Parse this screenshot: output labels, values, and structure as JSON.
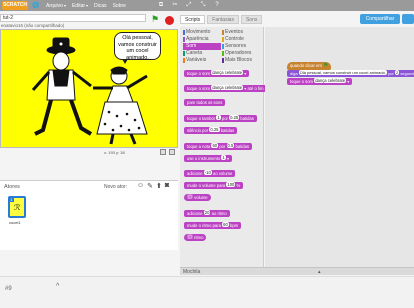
{
  "menubar": {
    "logo": "SCRATCH",
    "menus": [
      {
        "label": "Arquivo"
      },
      {
        "label": "Editar"
      },
      {
        "label": "Dicas"
      },
      {
        "label": "Sobre"
      }
    ]
  },
  "project": {
    "title": "tut-2",
    "subtitle": "enatavio16 (não compartilhado)"
  },
  "stage": {
    "speech": "Olá pessoal, vamos construir um cocel animado.",
    "background_color": "#ffff00",
    "coords": "x: 193  y: 38"
  },
  "sprites": {
    "title": "Atores",
    "new_sprite_label": "Novo ator:",
    "items": [
      {
        "number": "1",
        "name": "cocel1"
      }
    ]
  },
  "tabs": [
    {
      "label": "Scripts",
      "active": true
    },
    {
      "label": "Fantasias",
      "active": false
    },
    {
      "label": "Sons",
      "active": false
    }
  ],
  "share_button": "Compartilhar",
  "categories": [
    {
      "label": "Movimento",
      "key": "motion"
    },
    {
      "label": "Eventos",
      "key": "events"
    },
    {
      "label": "Aparência",
      "key": "looks"
    },
    {
      "label": "Controle",
      "key": "control"
    },
    {
      "label": "Som",
      "key": "sound",
      "selected": true
    },
    {
      "label": "Sensores",
      "key": "sensing"
    },
    {
      "label": "Caneta",
      "key": "pen"
    },
    {
      "label": "Operadores",
      "key": "operators"
    },
    {
      "label": "Variáveis",
      "key": "data"
    },
    {
      "label": "Mais Blocos",
      "key": "more"
    }
  ],
  "palette_blocks": [
    {
      "text": "toque o som",
      "slot": "dança celebrate"
    },
    {
      "text": "toque o som",
      "slot": "dança celebrate",
      "suffix": "até o fim"
    },
    {
      "text": "pare todos os sons"
    },
    {
      "text": "toque o tambor",
      "slot": "1",
      "mid": "por",
      "slot2": "0.25",
      "suffix": "batidas"
    },
    {
      "text": "silêncio por",
      "slot": "0.25",
      "suffix": "batidas"
    },
    {
      "text": "toque a nota",
      "slot": "60",
      "mid": "por",
      "slot2": "0.5",
      "suffix": "batidas"
    },
    {
      "text": "use o instrumento",
      "slot": "1"
    },
    {
      "text": "adicione",
      "slot": "-10",
      "suffix": "ao volume"
    },
    {
      "text": "mude o volume para",
      "slot": "100",
      "suffix": "%"
    },
    {
      "text": "volume",
      "reporter": true
    },
    {
      "text": "adicione",
      "slot": "20",
      "suffix": "ao ritmo"
    },
    {
      "text": "mude o ritmo para",
      "slot": "60",
      "suffix": "bpm"
    },
    {
      "text": "ritmo",
      "reporter": true
    }
  ],
  "script": {
    "hat": "quando clicar em",
    "say_prefix": "diga",
    "say_text": "Olá pessoal, vamos construir um cocel animado.",
    "say_mid": "por",
    "say_secs": "2",
    "say_suffix": "segundos",
    "play": "toque o som",
    "play_slot": "dança celebrate"
  },
  "backpack": {
    "label": "Mochila"
  },
  "bottom": {
    "label": "#9"
  }
}
